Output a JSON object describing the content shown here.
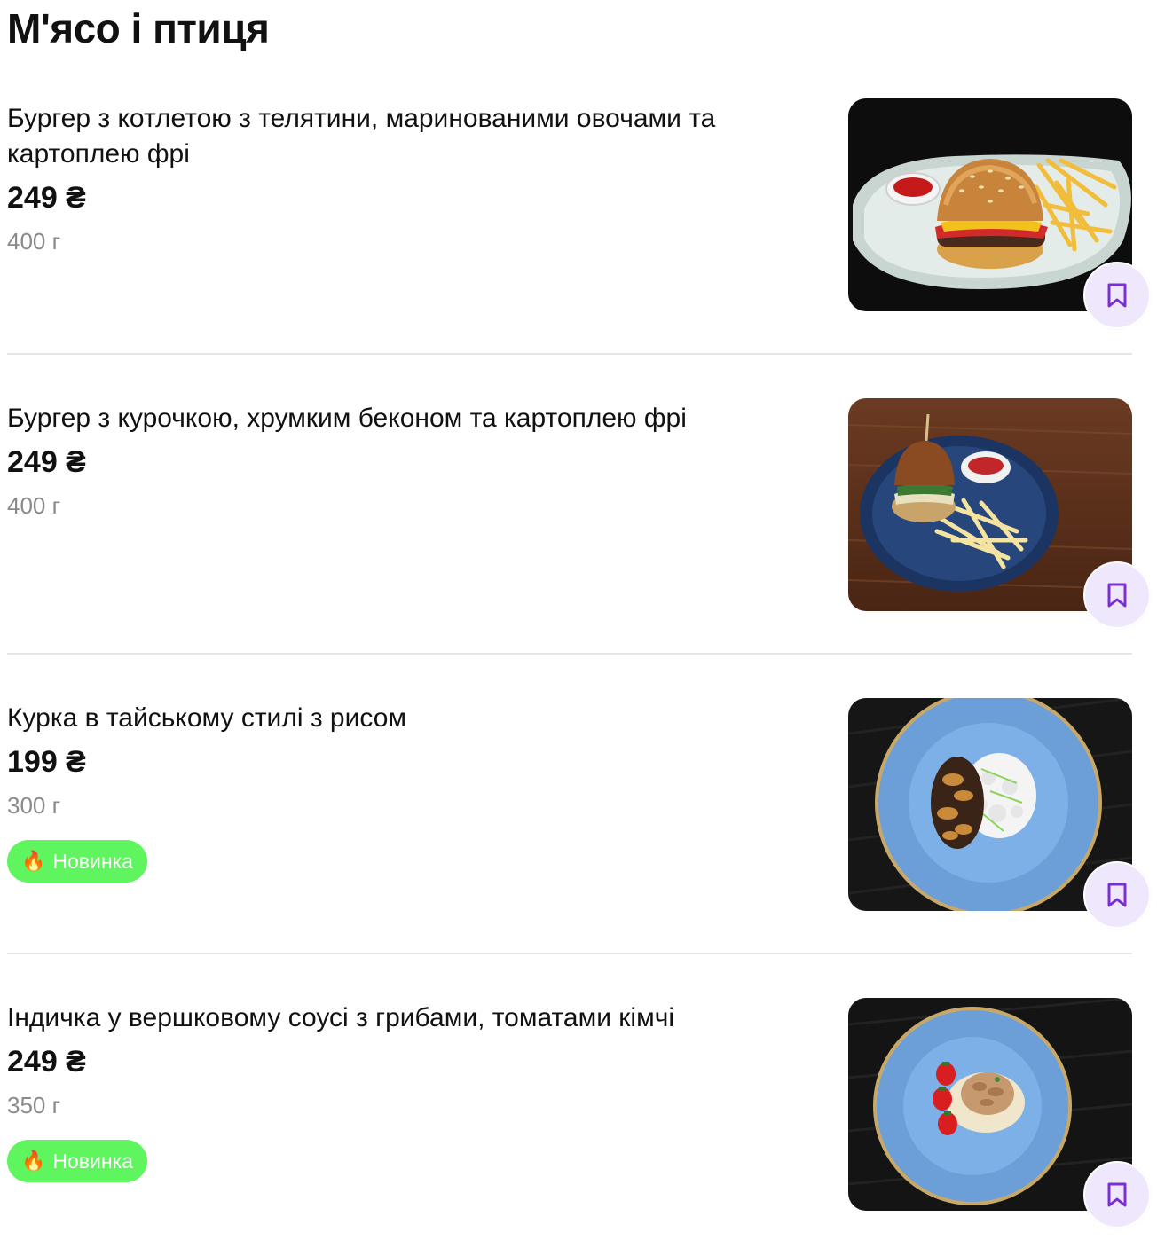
{
  "section": {
    "title": "М'ясо і птиця"
  },
  "theme": {
    "accent": "#7b2fd1",
    "fav_bg": "#efe8fd",
    "badge_bg": "#5ef55e"
  },
  "items": [
    {
      "name": "Бургер з котлетою з телятини, маринованими овочами та картоплею фрі",
      "price": "249 ₴",
      "weight": "400 г",
      "badge": null,
      "image": "veal-burger-with-fries-photo",
      "bookmark_icon": "bookmark-icon"
    },
    {
      "name": "Бургер з курочкою, хрумким беконом та картоплею фрі",
      "price": "249 ₴",
      "weight": "400 г",
      "badge": null,
      "image": "chicken-burger-with-fries-photo",
      "bookmark_icon": "bookmark-icon"
    },
    {
      "name": "Курка в тайському стилі з рисом",
      "price": "199 ₴",
      "weight": "300 г",
      "badge": {
        "icon": "🔥",
        "label": "Новинка"
      },
      "image": "thai-chicken-with-rice-photo",
      "bookmark_icon": "bookmark-icon"
    },
    {
      "name": "Індичка у вершковому соусі з грибами, томатами кімчі",
      "price": "249 ₴",
      "weight": "350 г",
      "badge": {
        "icon": "🔥",
        "label": "Новинка"
      },
      "image": "turkey-in-cream-sauce-photo",
      "bookmark_icon": "bookmark-icon"
    }
  ]
}
